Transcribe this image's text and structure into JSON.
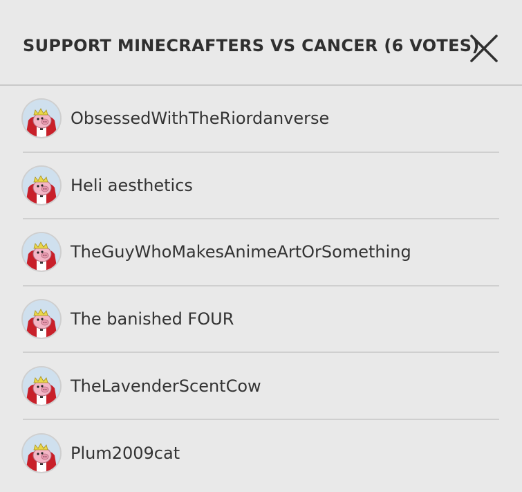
{
  "modal": {
    "title": "SUPPORT MINECRAFTERS VS CANCER (6 VOTES)",
    "close_icon": "close-icon"
  },
  "voters": [
    {
      "name": "ObsessedWithTheRiordanverse",
      "avatar_icon": "pig-king-avatar"
    },
    {
      "name": "Heli aesthetics",
      "avatar_icon": "pig-king-avatar"
    },
    {
      "name": "TheGuyWhoMakesAnimeArtOrSomething",
      "avatar_icon": "pig-king-avatar"
    },
    {
      "name": "The banished FOUR",
      "avatar_icon": "pig-king-avatar"
    },
    {
      "name": "TheLavenderScentCow",
      "avatar_icon": "pig-king-avatar"
    },
    {
      "name": "Plum2009cat",
      "avatar_icon": "pig-king-avatar"
    }
  ],
  "colors": {
    "background": "#e9e9e9",
    "text": "#333333",
    "divider": "#cfcfcf",
    "avatar_cape": "#c8202a",
    "avatar_pig": "#f3b6c6",
    "avatar_crown": "#e9d74a"
  }
}
